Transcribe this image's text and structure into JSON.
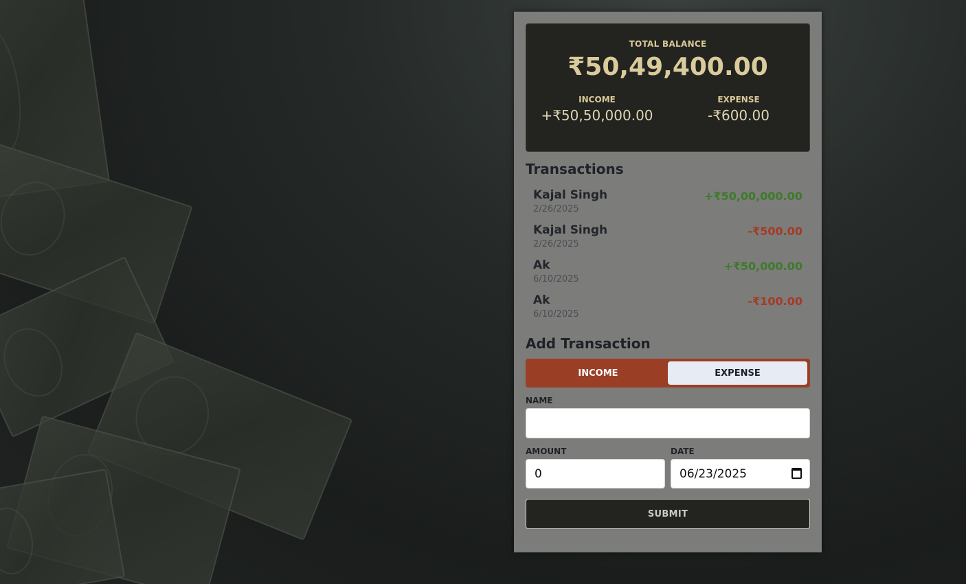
{
  "balance": {
    "total_label": "TOTAL BALANCE",
    "total_value": "₹50,49,400.00",
    "income_label": "INCOME",
    "income_value": "+₹50,50,000.00",
    "expense_label": "EXPENSE",
    "expense_value": "-₹600.00"
  },
  "transactions": {
    "title": "Transactions",
    "items": [
      {
        "name": "Kajal Singh",
        "date": "2/26/2025",
        "amount": "+₹50,00,000.00",
        "type": "income"
      },
      {
        "name": "Kajal Singh",
        "date": "2/26/2025",
        "amount": "-₹500.00",
        "type": "expense"
      },
      {
        "name": "Ak",
        "date": "6/10/2025",
        "amount": "+₹50,000.00",
        "type": "income"
      },
      {
        "name": "Ak",
        "date": "6/10/2025",
        "amount": "-₹100.00",
        "type": "expense"
      }
    ]
  },
  "form": {
    "title": "Add Transaction",
    "toggle_income": "INCOME",
    "toggle_expense": "EXPENSE",
    "name_label": "NAME",
    "name_value": "",
    "amount_label": "AMOUNT",
    "amount_value": "0",
    "date_label": "DATE",
    "date_value": "06/23/2025",
    "submit_label": "SUBMIT"
  },
  "icons": {
    "date_picker": "calendar-icon"
  },
  "colors": {
    "income": "#3e7a2b",
    "expense": "#a63a25",
    "toggle_bg": "#9a3f26",
    "card_bg": "#23231f",
    "accent_gold": "#d9cb9c"
  }
}
